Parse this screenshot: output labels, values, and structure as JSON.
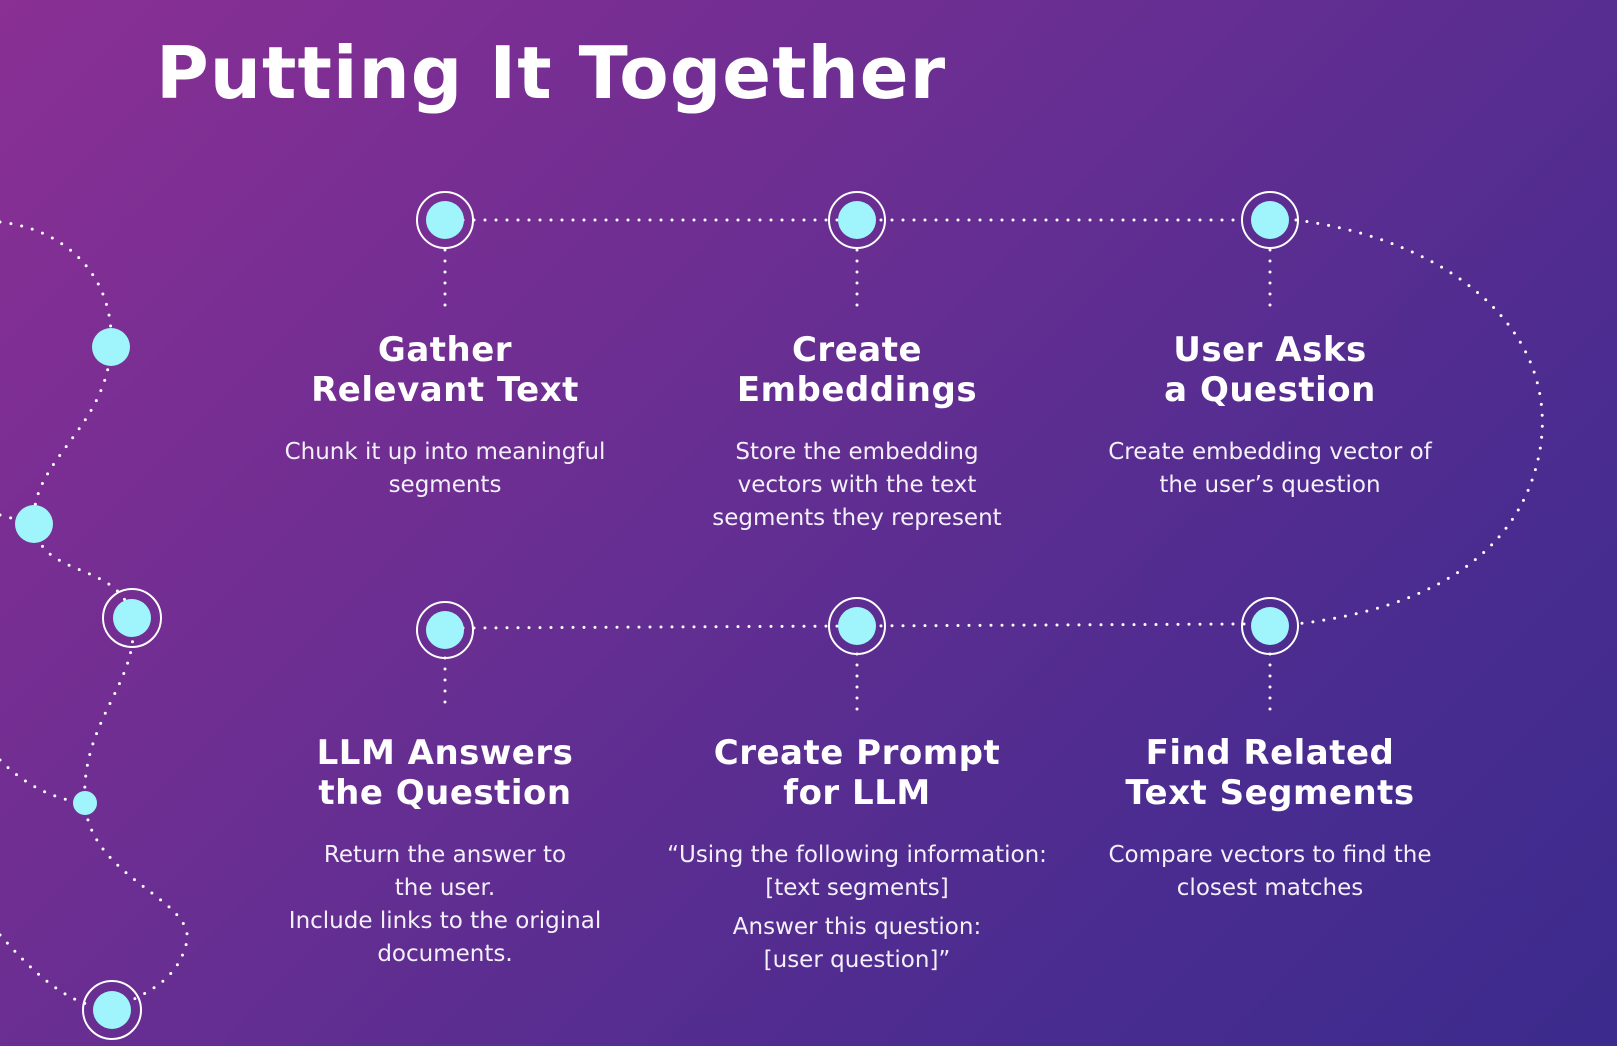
{
  "title": "Putting It Together",
  "colors": {
    "node_fill": "#9ff5fb",
    "ring": "#ffffff",
    "dots": "#ffffff"
  },
  "steps": [
    {
      "title_lines": [
        "Gather",
        "Relevant Text"
      ],
      "desc_lines": [
        "Chunk it up into meaningful",
        "segments"
      ]
    },
    {
      "title_lines": [
        "Create",
        "Embeddings"
      ],
      "desc_lines": [
        "Store the embedding",
        "vectors with the text",
        "segments they represent"
      ]
    },
    {
      "title_lines": [
        "User Asks",
        "a Question"
      ],
      "desc_lines": [
        "Create embedding vector of",
        "the user’s question"
      ]
    },
    {
      "title_lines": [
        "LLM Answers",
        "the Question"
      ],
      "desc_lines": [
        "Return the answer to",
        "the user.",
        "Include links to the original",
        "documents."
      ]
    },
    {
      "title_lines": [
        "Create Prompt",
        "for LLM"
      ],
      "desc_lines": [
        "“Using the following information:",
        "[text segments]"
      ],
      "desc2_lines": [
        "Answer this question:",
        "[user question]”"
      ]
    },
    {
      "title_lines": [
        "Find Related",
        "Text Segments"
      ],
      "desc_lines": [
        "Compare vectors to find the",
        "closest matches"
      ]
    }
  ]
}
